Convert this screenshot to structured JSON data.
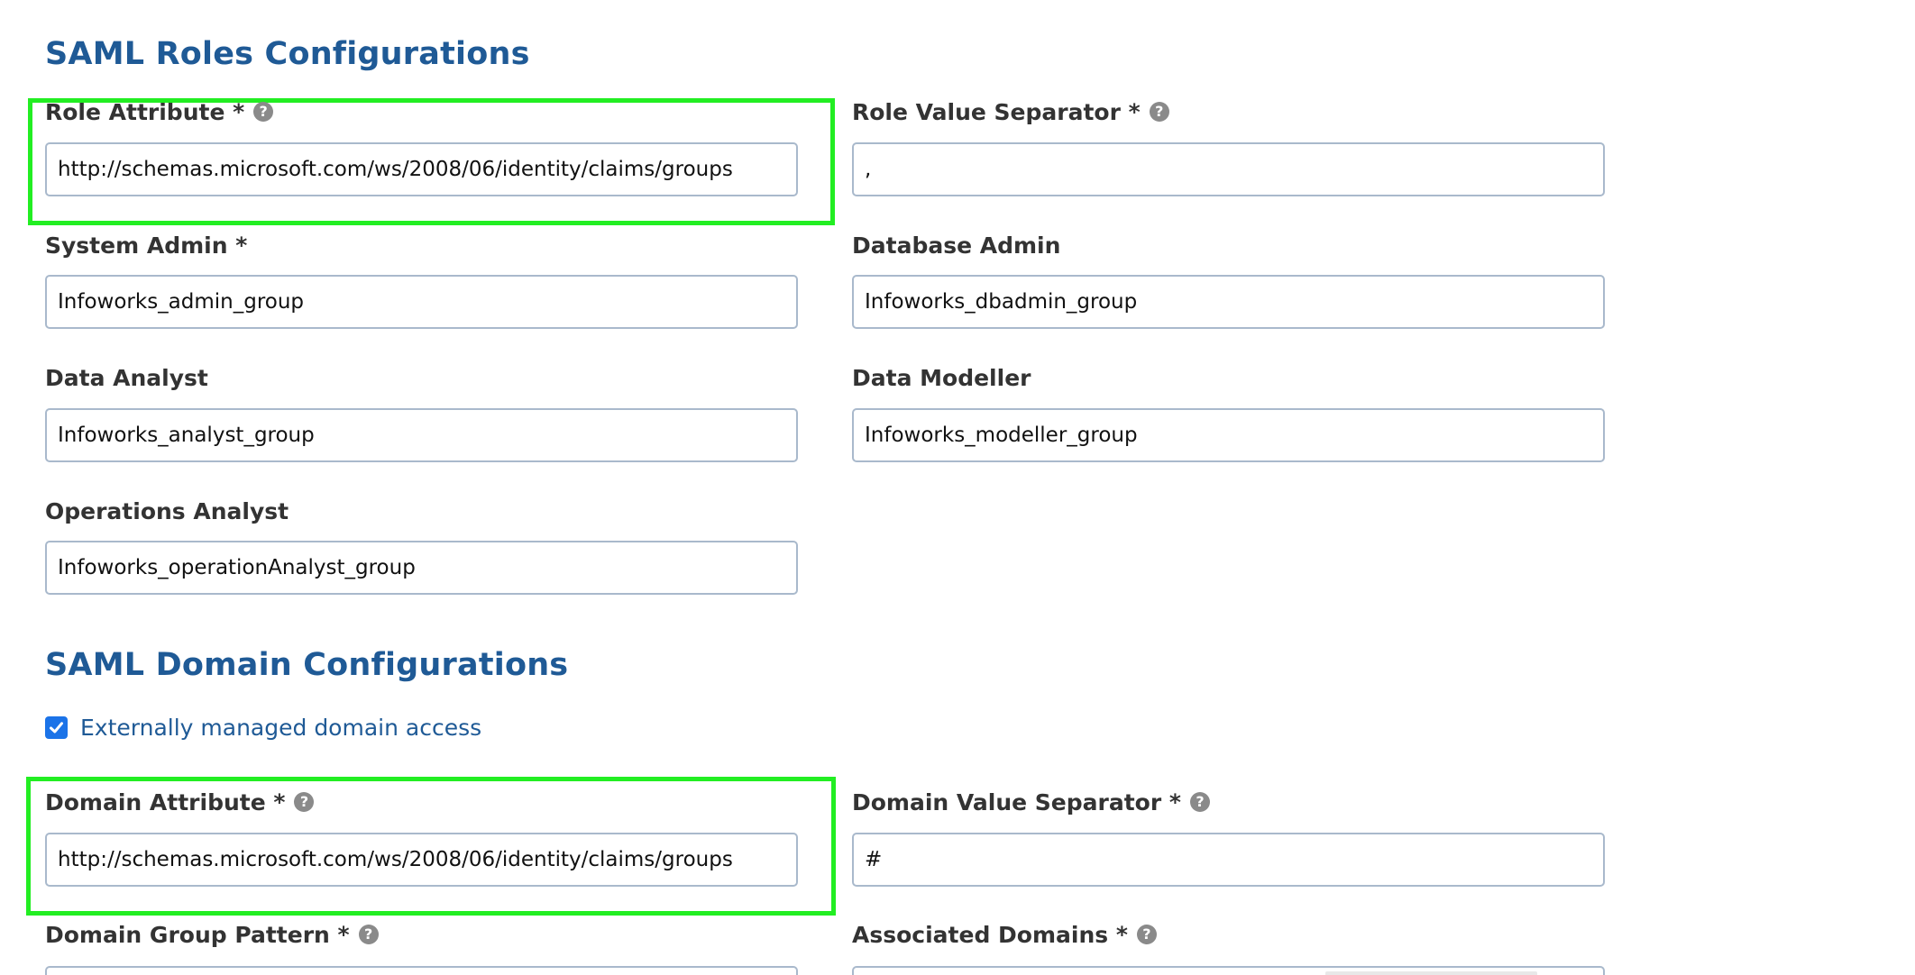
{
  "roles_section": {
    "title": "SAML Roles Configurations",
    "fields": {
      "role_attribute": {
        "label": "Role Attribute *",
        "value": "http://schemas.microsoft.com/ws/2008/06/identity/claims/groups"
      },
      "role_value_separator": {
        "label": "Role Value Separator *",
        "value": ","
      },
      "system_admin": {
        "label": "System Admin *",
        "value": "Infoworks_admin_group"
      },
      "database_admin": {
        "label": "Database Admin",
        "value": "Infoworks_dbadmin_group"
      },
      "data_analyst": {
        "label": "Data Analyst",
        "value": "Infoworks_analyst_group"
      },
      "data_modeller": {
        "label": "Data Modeller",
        "value": "Infoworks_modeller_group"
      },
      "operations_analyst": {
        "label": "Operations Analyst",
        "value": "Infoworks_operationAnalyst_group"
      }
    }
  },
  "domain_section": {
    "title": "SAML Domain Configurations",
    "external_domain_access": {
      "label": "Externally managed domain access",
      "checked": true
    },
    "fields": {
      "domain_attribute": {
        "label": "Domain Attribute *",
        "value": "http://schemas.microsoft.com/ws/2008/06/identity/claims/groups"
      },
      "domain_value_separator": {
        "label": "Domain Value Separator *",
        "value": "#"
      },
      "domain_group_pattern": {
        "label": "Domain Group Pattern *",
        "value": ""
      },
      "associated_domains": {
        "label": "Associated Domains *",
        "value": ""
      }
    }
  },
  "help_glyph": "?",
  "icons": {
    "help": "question-circle-icon",
    "check": "checkmark-icon"
  },
  "colors": {
    "section_title": "#1f5a96",
    "highlight": "#22ee22",
    "checkbox": "#1b73e8",
    "input_border": "#a9b9cc"
  }
}
